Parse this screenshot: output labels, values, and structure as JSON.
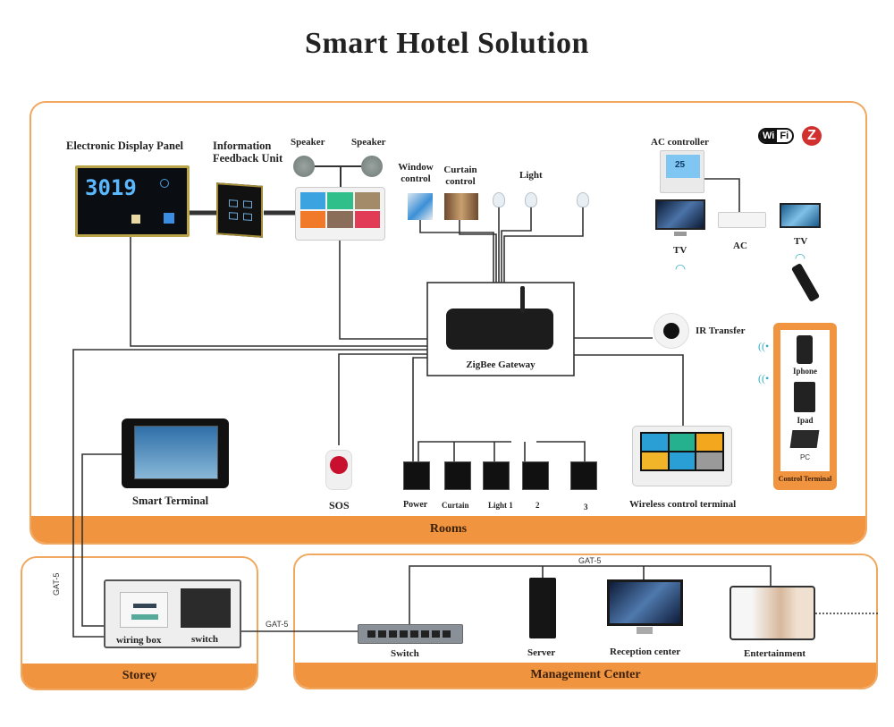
{
  "title": "Smart Hotel Solution",
  "colors": {
    "zone_border": "#f0a860",
    "zone_bar": "#f0943f",
    "wire": "#333333",
    "bar_text": "#3a1f0a"
  },
  "rooms": {
    "bar_label": "Rooms",
    "electronic_display_panel": {
      "label": "Electronic Display Panel",
      "room_number": "3019"
    },
    "info_feedback_unit": {
      "label": "Information Feedback Unit"
    },
    "speakers": [
      "Speaker",
      "Speaker"
    ],
    "window_control": "Window control",
    "curtain_control": "Curtain control",
    "light": "Light",
    "ac_controller": "AC controller",
    "ac_display": "25",
    "tv_left": "TV",
    "ac": "AC",
    "tv_right": "TV",
    "zigbee_gateway": "ZigBee Gateway",
    "ir_transfer": "IR Transfer",
    "smart_terminal": "Smart Terminal",
    "sos": "SOS",
    "switch_panels": [
      "Power",
      "Curtain",
      "Light 1",
      "2",
      "3"
    ],
    "wireless_control_terminal": "Wireless control terminal",
    "badges": {
      "wifi_left": "Wi",
      "wifi_right": "Fi",
      "zigbee": "Z"
    },
    "control_terminal": {
      "label": "Control Terminal",
      "devices": [
        "Iphone",
        "Ipad",
        "PC"
      ]
    }
  },
  "storey": {
    "bar_label": "Storey",
    "cable_vertical": "GAT-5",
    "cable_out": "GAT-5",
    "wiring_box": "wiring box",
    "switch": "switch"
  },
  "management": {
    "bar_label": "Management Center",
    "cable_top": "GAT-5",
    "switch": "Switch",
    "server": "Server",
    "reception_center": "Reception center",
    "entertainment": "Entertainment"
  }
}
